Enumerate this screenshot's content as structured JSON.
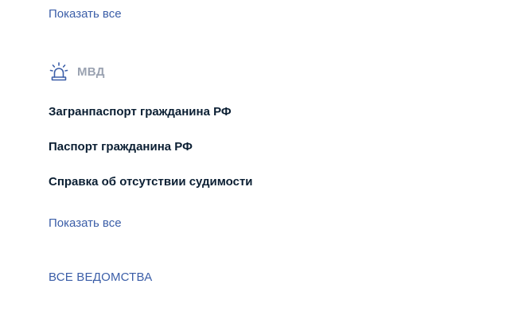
{
  "top_section": {
    "show_all_label": "Показать все"
  },
  "department": {
    "title": "МВД",
    "icon": "police-siren-icon",
    "services": [
      {
        "label": "Загранпаспорт гражданина РФ"
      },
      {
        "label": "Паспорт гражданина РФ"
      },
      {
        "label": "Справка об отсутствии судимости"
      }
    ],
    "show_all_label": "Показать все"
  },
  "footer": {
    "all_departments_label": "ВСЕ ВЕДОМСТВА"
  },
  "colors": {
    "link": "#3b5ea8",
    "text": "#0b1f33",
    "muted": "#9aa2b1"
  }
}
